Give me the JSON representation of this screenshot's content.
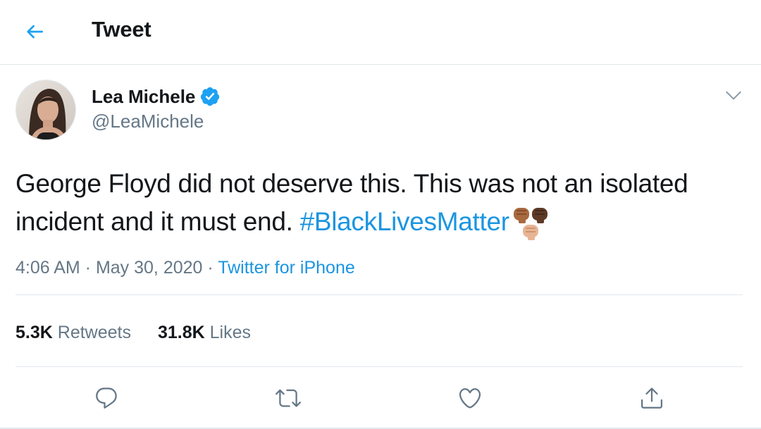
{
  "header": {
    "title": "Tweet",
    "back_icon": "arrow-left-icon"
  },
  "author": {
    "display_name": "Lea Michele",
    "handle": "@LeaMichele",
    "verified_icon": "verified-badge-icon",
    "avatar_icon": "avatar"
  },
  "tweet": {
    "text": "George Floyd did not deserve this. This was not an isolated incident and it must end. ",
    "hashtag": "#BlackLivesMatter",
    "emoji": "raised-fists-emoji"
  },
  "meta": {
    "time": "4:06 AM",
    "date": "May 30, 2020",
    "source": "Twitter for iPhone",
    "sep": " · "
  },
  "stats": {
    "retweets_count": "5.3K",
    "retweets_label": "Retweets",
    "likes_count": "31.8K",
    "likes_label": "Likes"
  },
  "actions": {
    "reply_icon": "reply-icon",
    "retweet_icon": "retweet-icon",
    "like_icon": "heart-icon",
    "share_icon": "share-icon"
  },
  "colors": {
    "accent": "#1b95e0",
    "text_primary": "#14171a",
    "text_secondary": "#657786",
    "border": "#e1e8ed"
  }
}
